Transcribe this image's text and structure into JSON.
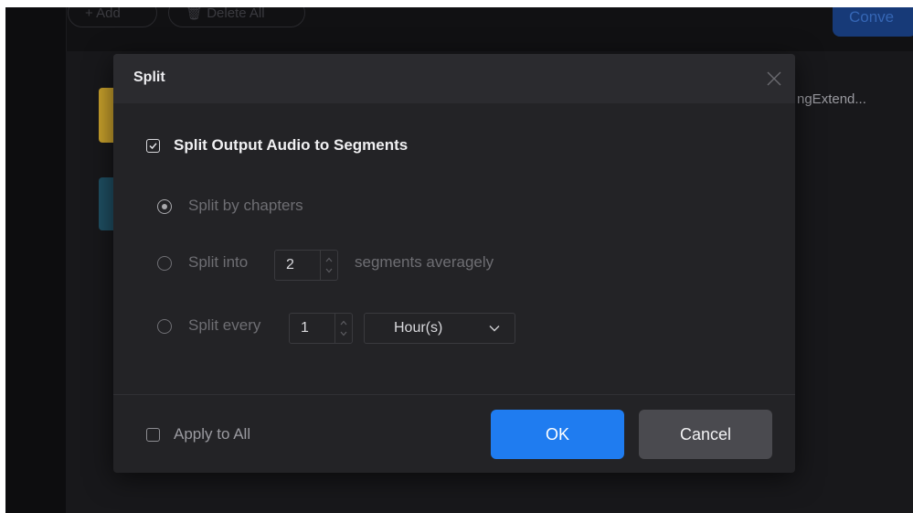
{
  "background": {
    "add_label": "+ Add",
    "delete_all_label": "🗑 Delete All",
    "convert_label": "Conve",
    "file_name_fragment": "ngExtend..."
  },
  "dialog": {
    "title": "Split",
    "main_option_label": "Split Output Audio to Segments",
    "main_option_checked": true,
    "options": [
      {
        "label": "Split by chapters",
        "selected": true
      },
      {
        "label": "Split into",
        "suffix": "segments averagely",
        "value": "2",
        "selected": false
      },
      {
        "label": "Split every",
        "value": "1",
        "unit": "Hour(s)",
        "selected": false
      }
    ],
    "apply_to_all_label": "Apply to All",
    "apply_to_all_checked": false,
    "ok_label": "OK",
    "cancel_label": "Cancel"
  },
  "colors": {
    "accent": "#1f7cf0",
    "dialog_bg": "#232326",
    "header_bg": "#2b2b2f"
  }
}
